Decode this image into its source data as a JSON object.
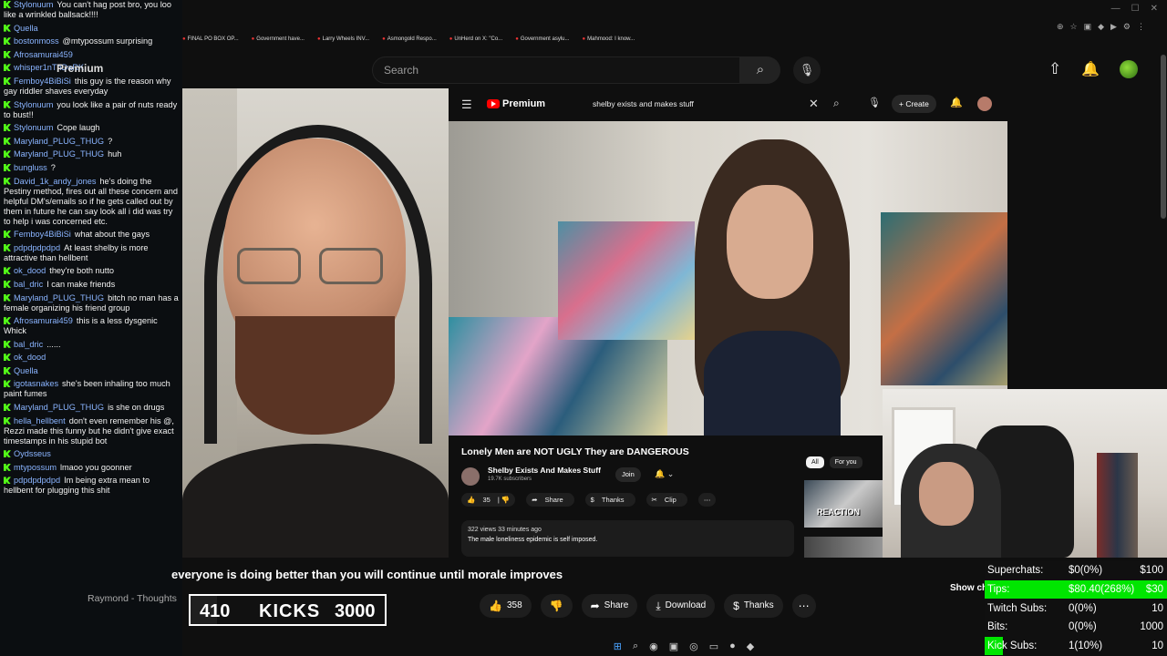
{
  "browser": {
    "bookmarks": [
      "FINAL PO BOX OP...",
      "Government have...",
      "Larry Wheels INV...",
      "Asmongold Respo...",
      "UnHerd on X: \"Co...",
      "Government asylu...",
      "Mahmood: I know..."
    ],
    "search_placeholder": "Search"
  },
  "chat": {
    "premium_label": "Premium",
    "messages": [
      {
        "user": "Stylonuum",
        "text": "You can't hag post bro, you loo like a wrinkled ballsack!!!!"
      },
      {
        "user": "Quella",
        "text": ""
      },
      {
        "user": "bostonmoss",
        "text": "@mtypossum surprising"
      },
      {
        "user": "Afrosamurai459",
        "text": ""
      },
      {
        "user": "whisper1nThDaRK",
        "text": ""
      },
      {
        "user": "Femboy4BiBiSi",
        "text": "this guy is the reason why gay riddler shaves everyday"
      },
      {
        "user": "Stylonuum",
        "text": "you look like a pair of nuts ready to bust!!"
      },
      {
        "user": "Stylonuum",
        "text": "Cope laugh"
      },
      {
        "user": "Maryland_PLUG_THUG",
        "text": "?"
      },
      {
        "user": "Maryland_PLUG_THUG",
        "text": "huh"
      },
      {
        "user": "bungluss",
        "text": "?"
      },
      {
        "user": "David_1k_andy_jones",
        "text": "he's doing the Pestiny method, fires out all these concern and helpful DM's/emails so if he gets called out by them in future he can say look all i did was try to help i was concerned etc."
      },
      {
        "user": "Femboy4BiBiSi",
        "text": "what about the gays"
      },
      {
        "user": "pdpdpdpdpd",
        "text": "At least shelby is more attractive than hellbent"
      },
      {
        "user": "ok_dood",
        "text": "they're both nutto"
      },
      {
        "user": "bal_dric",
        "text": "I can make friends"
      },
      {
        "user": "Maryland_PLUG_THUG",
        "text": "bitch no man has a female organizing his friend group"
      },
      {
        "user": "Afrosamurai459",
        "text": "this is a less dysgenic Whick"
      },
      {
        "user": "bal_dric",
        "text": "......"
      },
      {
        "user": "ok_dood",
        "text": ""
      },
      {
        "user": "Quella",
        "text": ""
      },
      {
        "user": "igotasnakes",
        "text": "she's been inhaling too much paint fumes"
      },
      {
        "user": "Maryland_PLUG_THUG",
        "text": "is she on drugs"
      },
      {
        "user": "hella_hellbent",
        "text": "don't even remember his @, Rezzi made this funny but he didn't give exact timestamps in his stupid bot"
      },
      {
        "user": "Oydsseus",
        "text": ""
      },
      {
        "user": "mtypossum",
        "text": "lmaoo you goonner"
      },
      {
        "user": "pdpdpdpdpd",
        "text": "Im being extra mean to hellbent for plugging this shit"
      }
    ]
  },
  "inner_youtube": {
    "logo": "Premium",
    "search_query": "shelby exists and makes stuff",
    "create_label": "Create",
    "video_title": "Lonely Men are NOT UGLY They are DANGEROUS",
    "channel_name": "Shelby Exists And Makes Stuff",
    "subscribers": "19.7K subscribers",
    "join_label": "Join",
    "actions": [
      "35",
      "Share",
      "Thanks",
      "Clip"
    ],
    "views_meta": "322 views  33 minutes ago",
    "description": "The male loneliness epidemic is self imposed.",
    "chips": [
      "All",
      "For you"
    ],
    "rec_thumb_text": "REACTION"
  },
  "ticker": {
    "text": "everyone is doing better than you will continue until morale improves"
  },
  "suggestion": {
    "text": "Raymond - Thoughts"
  },
  "kicks": {
    "current": "410",
    "label": "KICKS",
    "goal": "3000",
    "progress": 0.137
  },
  "actions": {
    "likes": "358",
    "share": "Share",
    "download": "Download",
    "thanks": "Thanks",
    "show_chat": "Show ch"
  },
  "stats": [
    {
      "label": "Superchats:",
      "value": "$0(0%)",
      "goal": "$100",
      "progress": 0
    },
    {
      "label": "Tips:",
      "value": "$80.40(268%)",
      "goal": "$30",
      "progress": 1
    },
    {
      "label": "Twitch Subs:",
      "value": "0(0%)",
      "goal": "10",
      "progress": 0
    },
    {
      "label": "Bits:",
      "value": "0(0%)",
      "goal": "1000",
      "progress": 0
    },
    {
      "label": "Kick Subs:",
      "value": "1(10%)",
      "goal": "10",
      "progress": 0.1
    }
  ],
  "colors": {
    "kick_green": "#53fc18",
    "bar_green": "#00e600",
    "yt_red": "#ff0000"
  }
}
